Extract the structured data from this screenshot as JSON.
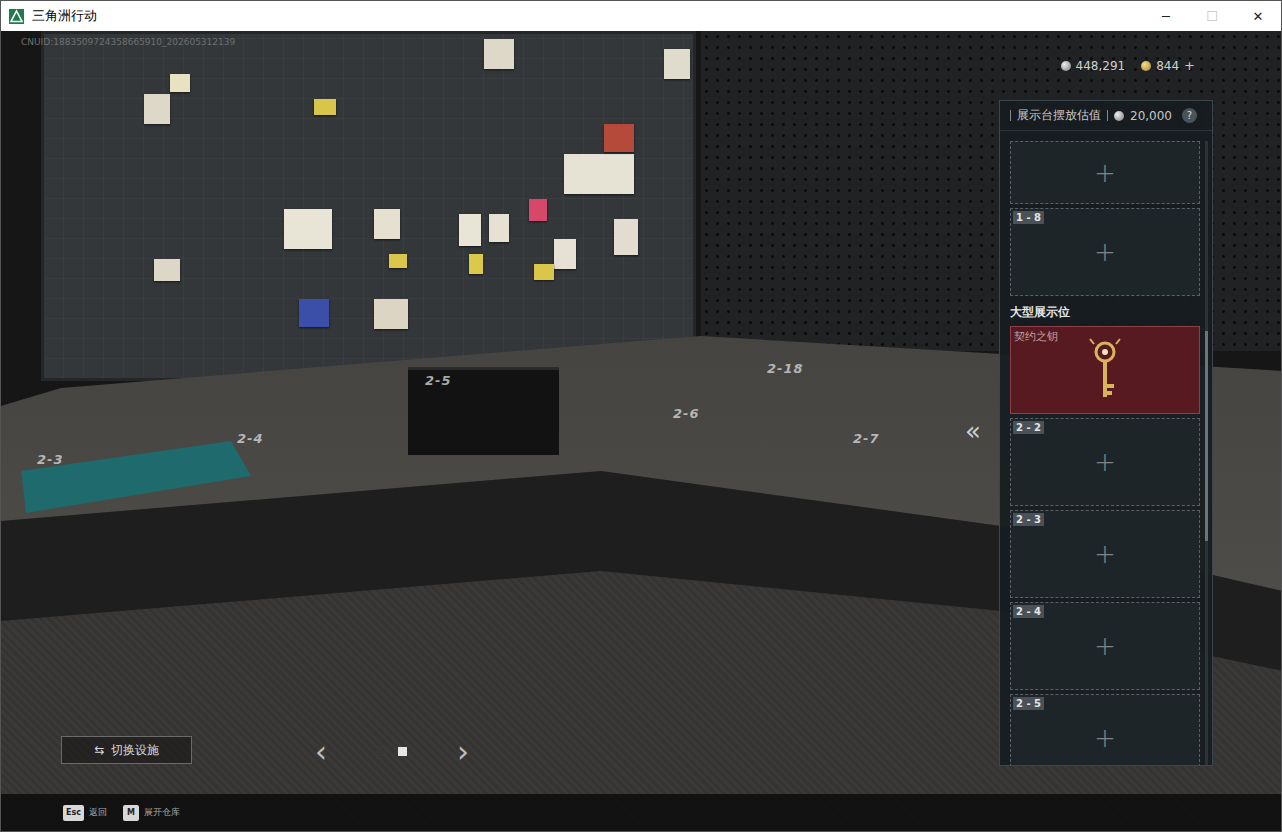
{
  "window": {
    "title": "三角洲行动",
    "controls": [
      {
        "glyph": "─",
        "disabled": false
      },
      {
        "glyph": "☐",
        "disabled": true
      },
      {
        "glyph": "✕",
        "disabled": false
      }
    ]
  },
  "cnuid": "CNUID:1883509724358665910_202605312139",
  "currencies": [
    {
      "amount": "448,291",
      "kind": "silver",
      "action": ""
    },
    {
      "amount": "844",
      "kind": "gold",
      "action": "+"
    }
  ],
  "scene_labels": [
    "2-3",
    "2-4",
    "2-5",
    "2-18",
    "2-6",
    "2-7"
  ],
  "display_panel": {
    "label": "展示台摆放估值",
    "value": "20,000",
    "help": "?",
    "collapse": "«",
    "rows": [
      {
        "kind": "slot",
        "label": "",
        "add": "+"
      },
      {
        "kind": "slot",
        "label": "1 - 8",
        "add": "+"
      },
      {
        "kind": "section",
        "label": "大型展示位"
      },
      {
        "kind": "item",
        "label": "契约之钥"
      },
      {
        "kind": "slot",
        "label": "2 - 2",
        "add": "+"
      },
      {
        "kind": "slot",
        "label": "2 - 3",
        "add": "+"
      },
      {
        "kind": "slot",
        "label": "2 - 4",
        "add": "+"
      },
      {
        "kind": "slot",
        "label": "2 - 5",
        "add": "+"
      }
    ]
  },
  "switch_button": {
    "icon": "⇆",
    "label": "切换设施"
  },
  "pager": {
    "prev": "‹",
    "next": "›",
    "pages": [
      {
        "selected": false
      },
      {
        "selected": true
      }
    ]
  },
  "hotkeys": [
    {
      "key": "Esc",
      "label": "返回"
    },
    {
      "key": "M",
      "label": "展开仓库"
    }
  ]
}
